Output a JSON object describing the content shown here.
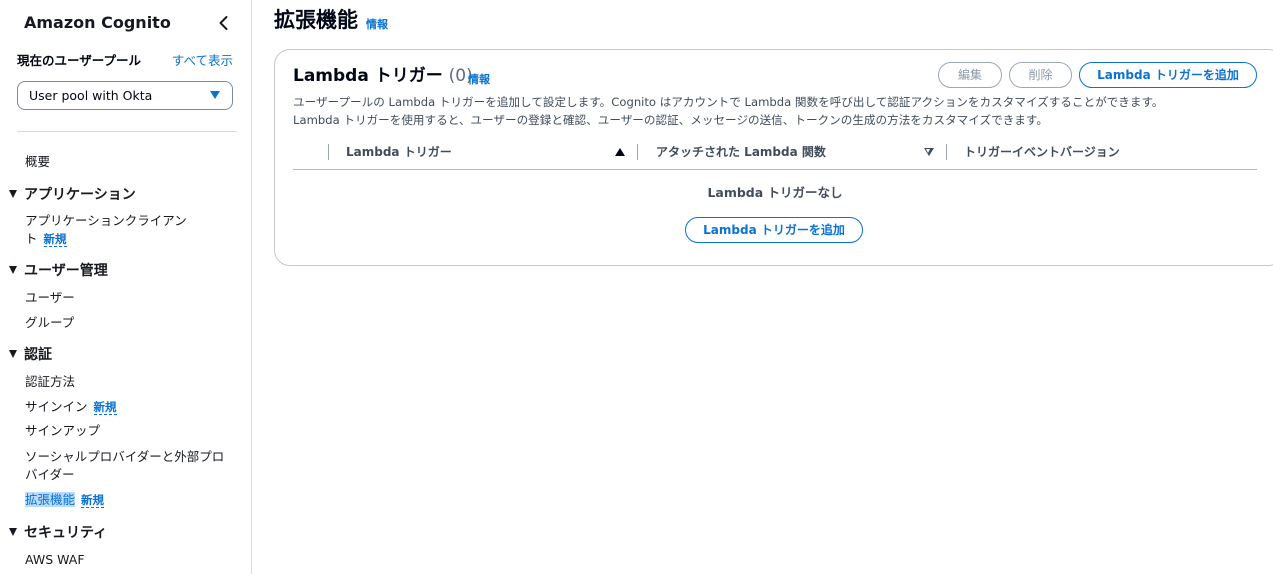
{
  "sidebar": {
    "title": "Amazon Cognito",
    "pool_label": "現在のユーザープール",
    "show_all": "すべて表示",
    "selected_pool": "User pool with Okta",
    "overview": "概要",
    "sections": {
      "applications": {
        "label": "アプリケーション",
        "app_clients_line1": "アプリケーションクライアン",
        "app_clients_line2": "ト",
        "app_clients_badge": "新規"
      },
      "user_management": {
        "label": "ユーザー管理",
        "users": "ユーザー",
        "groups": "グループ"
      },
      "auth": {
        "label": "認証",
        "methods": "認証方法",
        "signin": "サインイン",
        "signin_badge": "新規",
        "signup": "サインアップ",
        "social_line1": "ソーシャルプロバイダーと外部プロ",
        "social_line2": "バイダー",
        "extensions": "拡張機能",
        "extensions_badge": "新規"
      },
      "security": {
        "label": "セキュリティ",
        "waf": "AWS WAF"
      }
    }
  },
  "main": {
    "title": "拡張機能",
    "info": "情報",
    "panel": {
      "title": "Lambda トリガー",
      "count": "(0)",
      "info": "情報",
      "edit_button": "編集",
      "delete_button": "削除",
      "add_button": "Lambda トリガーを追加",
      "description_line1": "ユーザープールの Lambda トリガーを追加して設定します。Cognito はアカウントで Lambda 関数を呼び出して認証アクションをカスタマイズすることができます。",
      "description_line2": "Lambda トリガーを使用すると、ユーザーの登録と確認、ユーザーの認証、メッセージの送信、トークンの生成の方法をカスタマイズできます。",
      "columns": [
        "Lambda トリガー",
        "アタッチされた Lambda 関数",
        "トリガーイベントバージョン"
      ],
      "empty_text": "Lambda トリガーなし",
      "empty_add_button": "Lambda トリガーを追加"
    }
  },
  "colors": {
    "accent": "#0972d3",
    "active_bg": "#b9dcfc",
    "border": "#c6c6cd"
  },
  "icons": [
    "chevron-left-icon",
    "caret-down-icon",
    "triangle-down-icon",
    "sort-ascending-icon",
    "sort-descending-icon"
  ]
}
